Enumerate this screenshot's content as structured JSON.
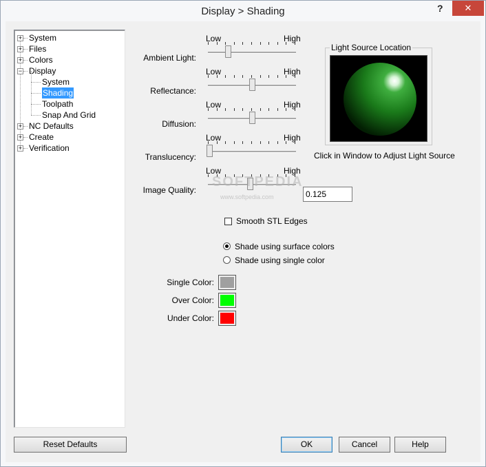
{
  "window": {
    "title": "Display > Shading",
    "help_glyph": "?",
    "close_glyph": "✕"
  },
  "tree": {
    "items": [
      {
        "label": "System",
        "level": 0,
        "expander": "+"
      },
      {
        "label": "Files",
        "level": 0,
        "expander": "+"
      },
      {
        "label": "Colors",
        "level": 0,
        "expander": "+"
      },
      {
        "label": "Display",
        "level": 0,
        "expander": "−"
      },
      {
        "label": "System",
        "level": 1
      },
      {
        "label": "Shading",
        "level": 1,
        "selected": true
      },
      {
        "label": "Toolpath",
        "level": 1
      },
      {
        "label": "Snap And Grid",
        "level": 1
      },
      {
        "label": "NC Defaults",
        "level": 0,
        "expander": "+"
      },
      {
        "label": "Create",
        "level": 0,
        "expander": "+"
      },
      {
        "label": "Verification",
        "level": 0,
        "expander": "+"
      }
    ]
  },
  "sliders": [
    {
      "label": "Ambient Light:",
      "low": "Low",
      "high": "High",
      "value": 0.22
    },
    {
      "label": "Reflectance:",
      "low": "Low",
      "high": "High",
      "value": 0.5
    },
    {
      "label": "Diffusion:",
      "low": "Low",
      "high": "High",
      "value": 0.5
    },
    {
      "label": "Translucency:",
      "low": "Low",
      "high": "High",
      "value": 0.0
    },
    {
      "label": "Image Quality:",
      "low": "Low",
      "high": "High",
      "value": 0.48
    }
  ],
  "image_quality_value": "0.125",
  "light_source": {
    "group_title": "Light Source Location",
    "caption": "Click in Window to Adjust Light Source",
    "sphere_color": "#1f8a1f"
  },
  "smooth_stl": {
    "label": "Smooth STL Edges",
    "checked": false
  },
  "shade_options": [
    {
      "label": "Shade using surface colors",
      "selected": true
    },
    {
      "label": "Shade using single color",
      "selected": false
    }
  ],
  "colors": [
    {
      "label": "Single Color:",
      "hex": "#a0a0a0"
    },
    {
      "label": "Over Color:",
      "hex": "#00ff00"
    },
    {
      "label": "Under Color:",
      "hex": "#ff0000"
    }
  ],
  "buttons": {
    "reset": "Reset Defaults",
    "ok": "OK",
    "cancel": "Cancel",
    "help": "Help"
  },
  "watermark": {
    "text": "SOFTPEDIA",
    "sub": "www.softpedia.com"
  }
}
